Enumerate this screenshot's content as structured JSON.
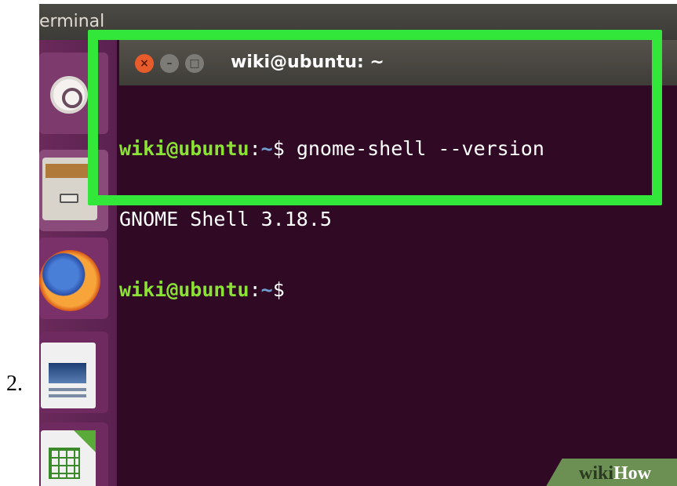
{
  "step_number": "2.",
  "top_bar": {
    "title": "erminal"
  },
  "launcher": {
    "items": [
      {
        "name": "Dash",
        "icon": "ubuntu-logo-icon"
      },
      {
        "name": "Files",
        "icon": "file-cabinet-icon"
      },
      {
        "name": "Firefox",
        "icon": "firefox-icon"
      },
      {
        "name": "LibreOffice Writer",
        "icon": "writer-document-icon"
      },
      {
        "name": "LibreOffice Calc",
        "icon": "spreadsheet-icon"
      }
    ]
  },
  "terminal": {
    "title": "wiki@ubuntu: ~",
    "buttons": {
      "close": "×",
      "minimize": "–",
      "maximize": "□"
    },
    "lines": [
      {
        "user": "wiki@ubuntu",
        "sep": ":",
        "path": "~",
        "symbol": "$ ",
        "command": "gnome-shell --version"
      },
      {
        "output": "GNOME Shell 3.18.5"
      },
      {
        "user": "wiki@ubuntu",
        "sep": ":",
        "path": "~",
        "symbol": "$",
        "command": ""
      }
    ]
  },
  "highlight_color": "#33e63a",
  "watermark": {
    "part1": "wiki",
    "part2": "How"
  }
}
